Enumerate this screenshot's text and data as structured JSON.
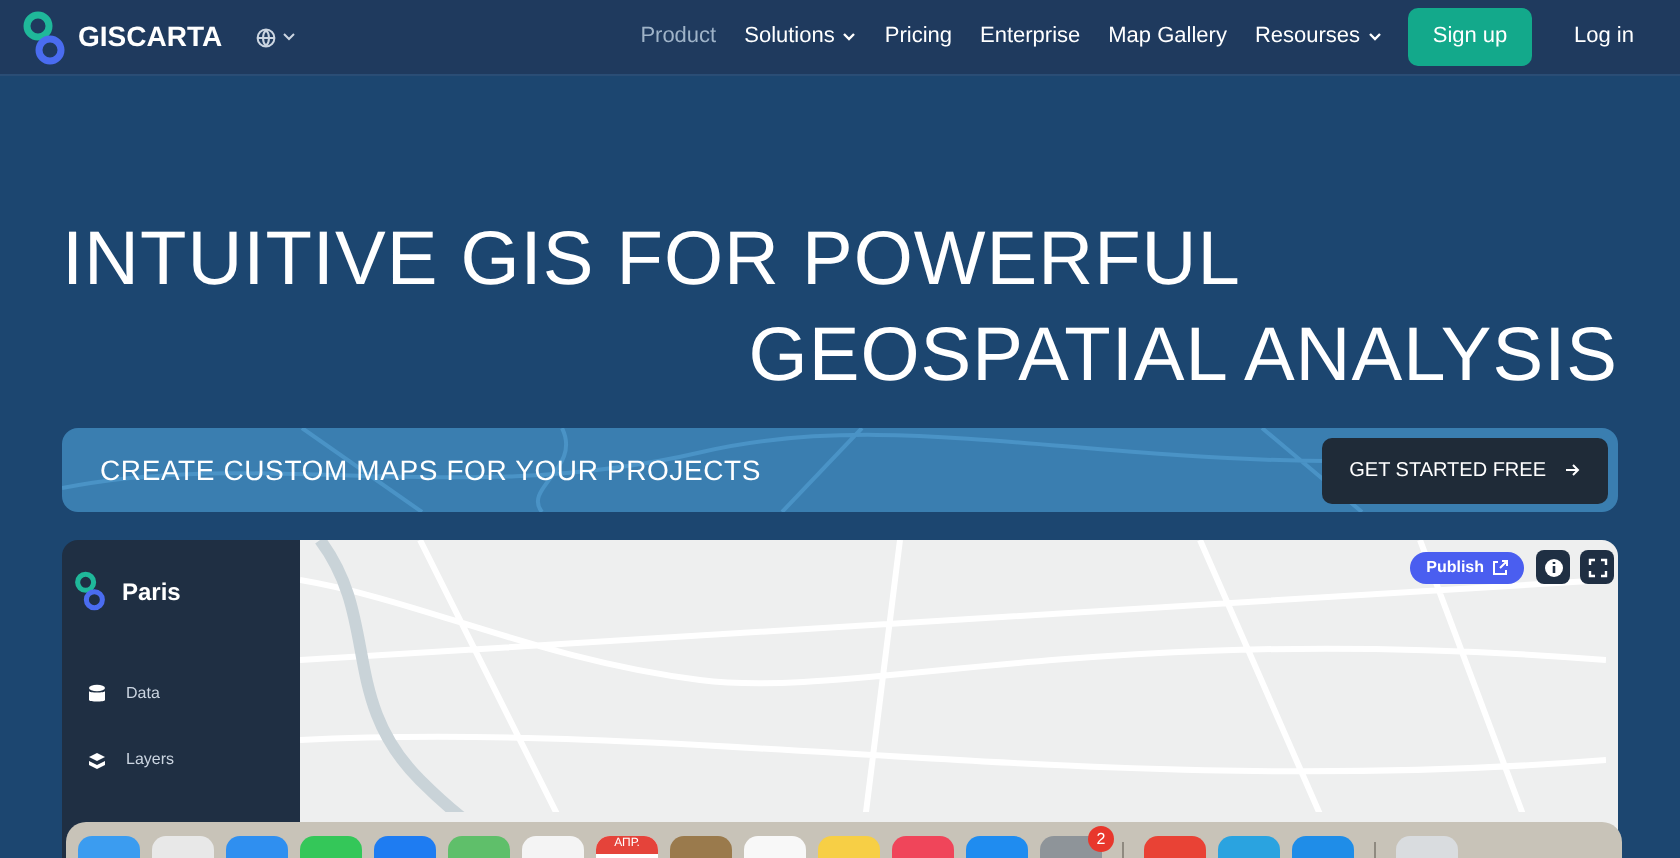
{
  "nav": {
    "brand": "GISCARTA",
    "items": [
      {
        "label": "Product",
        "selected": true,
        "dropdown": false
      },
      {
        "label": "Solutions",
        "selected": false,
        "dropdown": true
      },
      {
        "label": "Pricing",
        "selected": false,
        "dropdown": false
      },
      {
        "label": "Enterprise",
        "selected": false,
        "dropdown": false
      },
      {
        "label": "Map Gallery",
        "selected": false,
        "dropdown": false
      },
      {
        "label": "Resourses",
        "selected": false,
        "dropdown": true
      }
    ],
    "signup": "Sign up",
    "login": "Log in"
  },
  "hero": {
    "line_1": "INTUITIVE GIS FOR POWERFUL",
    "line_2": "GEOSPATIAL ANALYSIS"
  },
  "banner": {
    "text": "CREATE CUSTOM MAPS FOR YOUR PROJECTS",
    "button": "GET STARTED FREE"
  },
  "app": {
    "title": "Paris",
    "menu": [
      {
        "label": "Data",
        "kind": "data"
      },
      {
        "label": "Layers",
        "kind": "layers"
      }
    ],
    "publish": "Publish"
  },
  "dock": {
    "apps": [
      {
        "kind": "app",
        "color": "#3b9cf0"
      },
      {
        "kind": "app",
        "color": "#e8e8e8"
      },
      {
        "kind": "app",
        "color": "#2f8ff0"
      },
      {
        "kind": "app",
        "color": "#34c759"
      },
      {
        "kind": "app",
        "color": "#1e7cf2"
      },
      {
        "kind": "app",
        "color": "#5fbf6a"
      },
      {
        "kind": "app",
        "color": "#f4f4f4"
      },
      {
        "kind": "calendar",
        "color": "#ffffff",
        "label": "АПР."
      },
      {
        "kind": "app",
        "color": "#9a7a4c"
      },
      {
        "kind": "app",
        "color": "#f8f8f8"
      },
      {
        "kind": "app",
        "color": "#f7cf45"
      },
      {
        "kind": "app",
        "color": "#f0455a"
      },
      {
        "kind": "app",
        "color": "#1f8cf0"
      },
      {
        "kind": "badged",
        "color": "#8e9499",
        "badge": "2"
      },
      {
        "kind": "separator"
      },
      {
        "kind": "app",
        "color": "#e94235"
      },
      {
        "kind": "app",
        "color": "#2aa3e0"
      },
      {
        "kind": "app",
        "color": "#1f8de8"
      },
      {
        "kind": "separator"
      },
      {
        "kind": "app",
        "color": "#d9dcdf"
      }
    ]
  }
}
